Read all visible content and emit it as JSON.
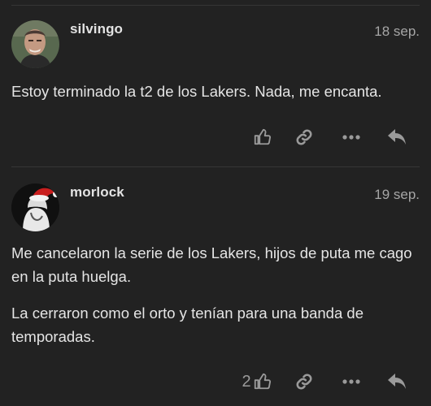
{
  "posts": [
    {
      "username": "silvingo",
      "date": "18 sep.",
      "paragraphs": [
        "Estoy terminado la t2 de los Lakers. Nada, me encanta."
      ],
      "likes": "",
      "avatar_icon": "man-portrait-avatar"
    },
    {
      "username": "morlock",
      "date": "19 sep.",
      "paragraphs": [
        "Me cancelaron la serie de los Lakers, hijos de puta me cago en la puta huelga.",
        "La cerraron como el orto y tenían para una banda de temporadas."
      ],
      "likes": "2",
      "avatar_icon": "santa-hat-avatar"
    }
  ],
  "icons": {
    "like": "thumbs-up-icon",
    "link": "link-icon",
    "more": "ellipsis-icon",
    "reply": "reply-arrow-icon"
  },
  "colors": {
    "background": "#222222",
    "text": "#e5e5e5",
    "muted": "#9a9a9a",
    "divider": "#363636"
  }
}
